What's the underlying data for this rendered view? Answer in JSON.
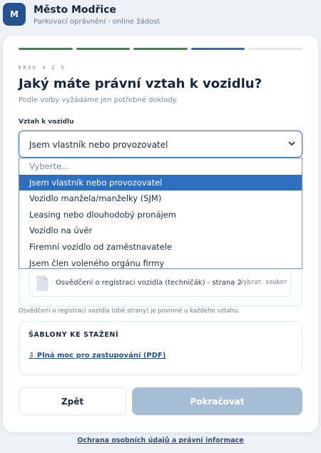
{
  "header": {
    "logo_letter": "M",
    "title": "Město Modřice",
    "subtitle": "Parkovací oprávnění · online žádost"
  },
  "progress": {
    "total_steps": 5,
    "current_step": 4,
    "step_states": [
      "done",
      "done",
      "done",
      "active",
      "pending"
    ],
    "colors": {
      "done": "#3b8a52",
      "active": "#2d6fb5",
      "pending": "#e3e7ed"
    }
  },
  "step": {
    "kicker": "KROK 4 Z 5",
    "title": "Jaký máte právní vztah k vozidlu?",
    "subtitle": "Podle volby vyžádáme jen potřebné doklady."
  },
  "relation_field": {
    "label": "Vztah k vozidlu",
    "value": "Jsem vlastník nebo provozovatel",
    "options": [
      {
        "label": "Vyberte...",
        "placeholder": true
      },
      {
        "label": "Jsem vlastník nebo provozovatel",
        "selected": true
      },
      {
        "label": "Vozidlo manžela/manželky (SJM)"
      },
      {
        "label": "Leasing nebo dlouhodobý pronájem"
      },
      {
        "label": "Vozidlo na úvěr"
      },
      {
        "label": "Firemní vozidlo od zaměstnavatele"
      },
      {
        "label": "Jsem člen voleného orgánu firmy"
      }
    ]
  },
  "upload": {
    "file_name": "Osvědčení o registraci vozidla (techničák) - strana 2",
    "select_button": "Vybrat soubor",
    "hint": "Osvědčení o registraci vozidla (obě strany) je povinné u každého vztahu."
  },
  "templates": {
    "title": "ŠABLONY KE STAŽENÍ",
    "link": "⇩ Plná moc pro zastupování (PDF)"
  },
  "actions": {
    "back": "Zpět",
    "next": "Pokračovat"
  },
  "footer": {
    "link": "Ochrana osobních údajů a právní informace"
  },
  "colors": {
    "brand": "#24528f",
    "accent": "#2d6fb5",
    "next_disabled": "#a6bdd6"
  }
}
